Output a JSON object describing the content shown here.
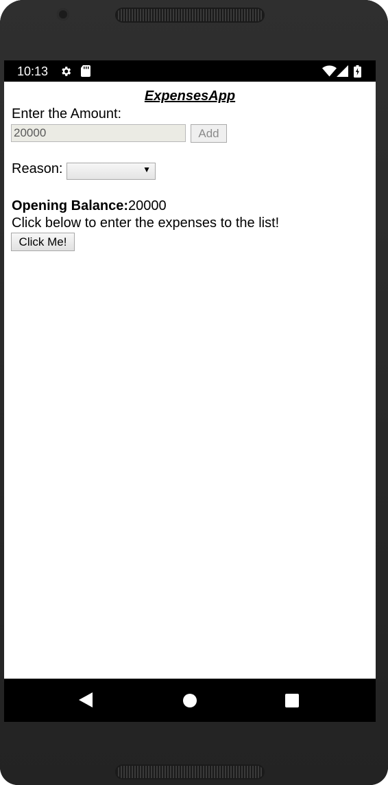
{
  "status_bar": {
    "time": "10:13"
  },
  "app": {
    "title": "ExpensesApp"
  },
  "form": {
    "amount_label": "Enter the Amount:",
    "amount_value": "20000",
    "add_label": "Add",
    "reason_label": "Reason:",
    "reason_selected": ""
  },
  "summary": {
    "balance_label": "Opening Balance:",
    "balance_value": "20000",
    "instruction": "Click below to enter the expenses to the list!",
    "click_label": "Click Me!"
  },
  "icons": {
    "status_settings": "gear-icon",
    "status_storage": "sd-card-icon",
    "status_wifi": "wifi-icon",
    "status_signal": "signal-icon",
    "status_battery": "battery-icon",
    "nav_back": "back-icon",
    "nav_home": "home-icon",
    "nav_recent": "recent-apps-icon"
  },
  "colors": {
    "status_bar": "#000000",
    "navigation_bar": "#000000",
    "device_body": "#2a2a2a",
    "input_disabled": "#ebebe4"
  }
}
